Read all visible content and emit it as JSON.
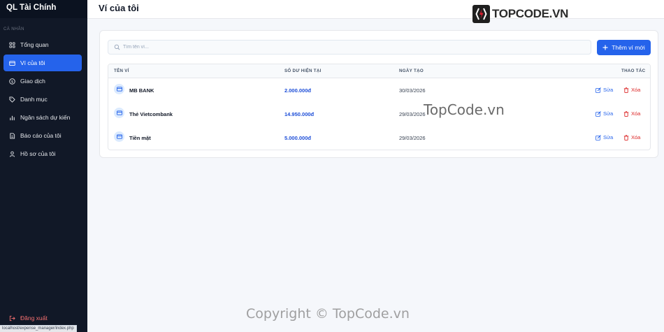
{
  "app": {
    "brand": "QL Tài Chính"
  },
  "sidebar": {
    "section_label": "CÁ NHÂN",
    "items": [
      {
        "label": "Tổng quan",
        "icon": "dashboard-icon"
      },
      {
        "label": "Ví của tôi",
        "icon": "wallet-icon",
        "active": true
      },
      {
        "label": "Giao dịch",
        "icon": "dollar-icon"
      },
      {
        "label": "Danh mục",
        "icon": "tag-icon"
      },
      {
        "label": "Ngân sách dự kiến",
        "icon": "bar-chart-icon"
      },
      {
        "label": "Báo cáo của tôi",
        "icon": "report-icon"
      },
      {
        "label": "Hồ sơ của tôi",
        "icon": "user-icon"
      }
    ],
    "logout_label": "Đăng xuất"
  },
  "status_bar": {
    "url": "localhost/expense_manager/index.php"
  },
  "header": {
    "title": "Ví của tôi"
  },
  "logo": {
    "text": "TOPCODE.VN"
  },
  "search": {
    "placeholder": "Tìm tên ví..."
  },
  "toolbar": {
    "add_label": "Thêm ví mới"
  },
  "table": {
    "columns": [
      "TÊN VÍ",
      "SỐ DƯ HIỆN TẠI",
      "NGÀY TẠO",
      "THAO TÁC"
    ],
    "rows": [
      {
        "name": "MB BANK",
        "balance": "2.000.000đ",
        "date": "30/03/2026"
      },
      {
        "name": "Thẻ Vietcombank",
        "balance": "14.950.000đ",
        "date": "29/03/2026"
      },
      {
        "name": "Tiền mặt",
        "balance": "5.000.000đ",
        "date": "29/03/2026"
      }
    ],
    "edit_label": "Sửa",
    "delete_label": "Xóa"
  },
  "watermarks": {
    "center": "TopCode.vn",
    "bottom": "Copyright © TopCode.vn"
  },
  "colors": {
    "accent": "#2563eb",
    "sidebar": "#111827",
    "danger": "#dc2626"
  }
}
